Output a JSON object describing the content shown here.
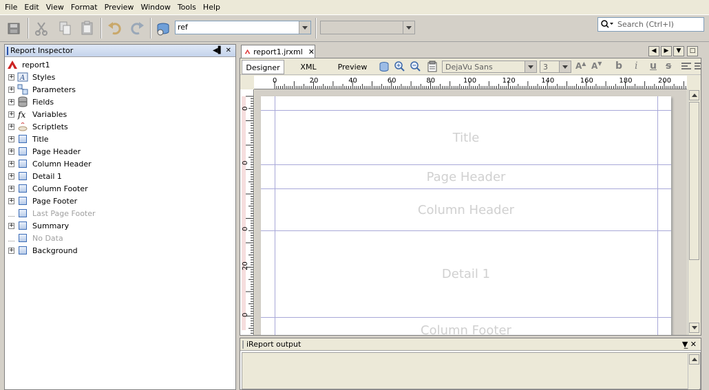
{
  "menu": [
    "File",
    "Edit",
    "View",
    "Format",
    "Preview",
    "Window",
    "Tools",
    "Help"
  ],
  "toolbar": {
    "expression_value": "ref",
    "search_placeholder": "Search (Ctrl+I)"
  },
  "inspector": {
    "title": "Report Inspector",
    "root": "report1",
    "items": [
      {
        "label": "Styles",
        "expandable": true,
        "enabled": true,
        "icon": "styles-icon"
      },
      {
        "label": "Parameters",
        "expandable": true,
        "enabled": true,
        "icon": "parameters-icon"
      },
      {
        "label": "Fields",
        "expandable": true,
        "enabled": true,
        "icon": "fields-icon"
      },
      {
        "label": "Variables",
        "expandable": true,
        "enabled": true,
        "icon": "variables-icon"
      },
      {
        "label": "Scriptlets",
        "expandable": true,
        "enabled": true,
        "icon": "scriptlets-icon"
      },
      {
        "label": "Title",
        "expandable": true,
        "enabled": true,
        "icon": "band-icon"
      },
      {
        "label": "Page Header",
        "expandable": true,
        "enabled": true,
        "icon": "band-icon"
      },
      {
        "label": "Column Header",
        "expandable": true,
        "enabled": true,
        "icon": "band-icon"
      },
      {
        "label": "Detail 1",
        "expandable": true,
        "enabled": true,
        "icon": "band-icon"
      },
      {
        "label": "Column Footer",
        "expandable": true,
        "enabled": true,
        "icon": "band-icon"
      },
      {
        "label": "Page Footer",
        "expandable": true,
        "enabled": true,
        "icon": "band-icon"
      },
      {
        "label": "Last Page Footer",
        "expandable": false,
        "enabled": false,
        "icon": "band-icon"
      },
      {
        "label": "Summary",
        "expandable": true,
        "enabled": true,
        "icon": "band-icon"
      },
      {
        "label": "No Data",
        "expandable": false,
        "enabled": false,
        "icon": "band-icon"
      },
      {
        "label": "Background",
        "expandable": true,
        "enabled": true,
        "icon": "band-icon"
      }
    ]
  },
  "editor": {
    "tab_label": "report1.jrxml",
    "views": [
      "Designer",
      "XML",
      "Preview"
    ],
    "font": "DejaVu Sans",
    "font_size": "3",
    "format_labels": [
      "b",
      "i",
      "u",
      "s"
    ],
    "ruler_h": [
      "0",
      "20",
      "40",
      "60",
      "80",
      "100",
      "120",
      "140",
      "160",
      "180",
      "200"
    ],
    "ruler_v": [
      "0",
      "0",
      "0",
      "20",
      "0"
    ],
    "bands": [
      "Title",
      "Page Header",
      "Column Header",
      "Detail 1",
      "Column Footer"
    ]
  },
  "output": {
    "title": "iReport output"
  },
  "colors": {
    "accent": "#2851a8",
    "band_line": "#a8a8d8",
    "band_text": "#d0d0d0"
  }
}
